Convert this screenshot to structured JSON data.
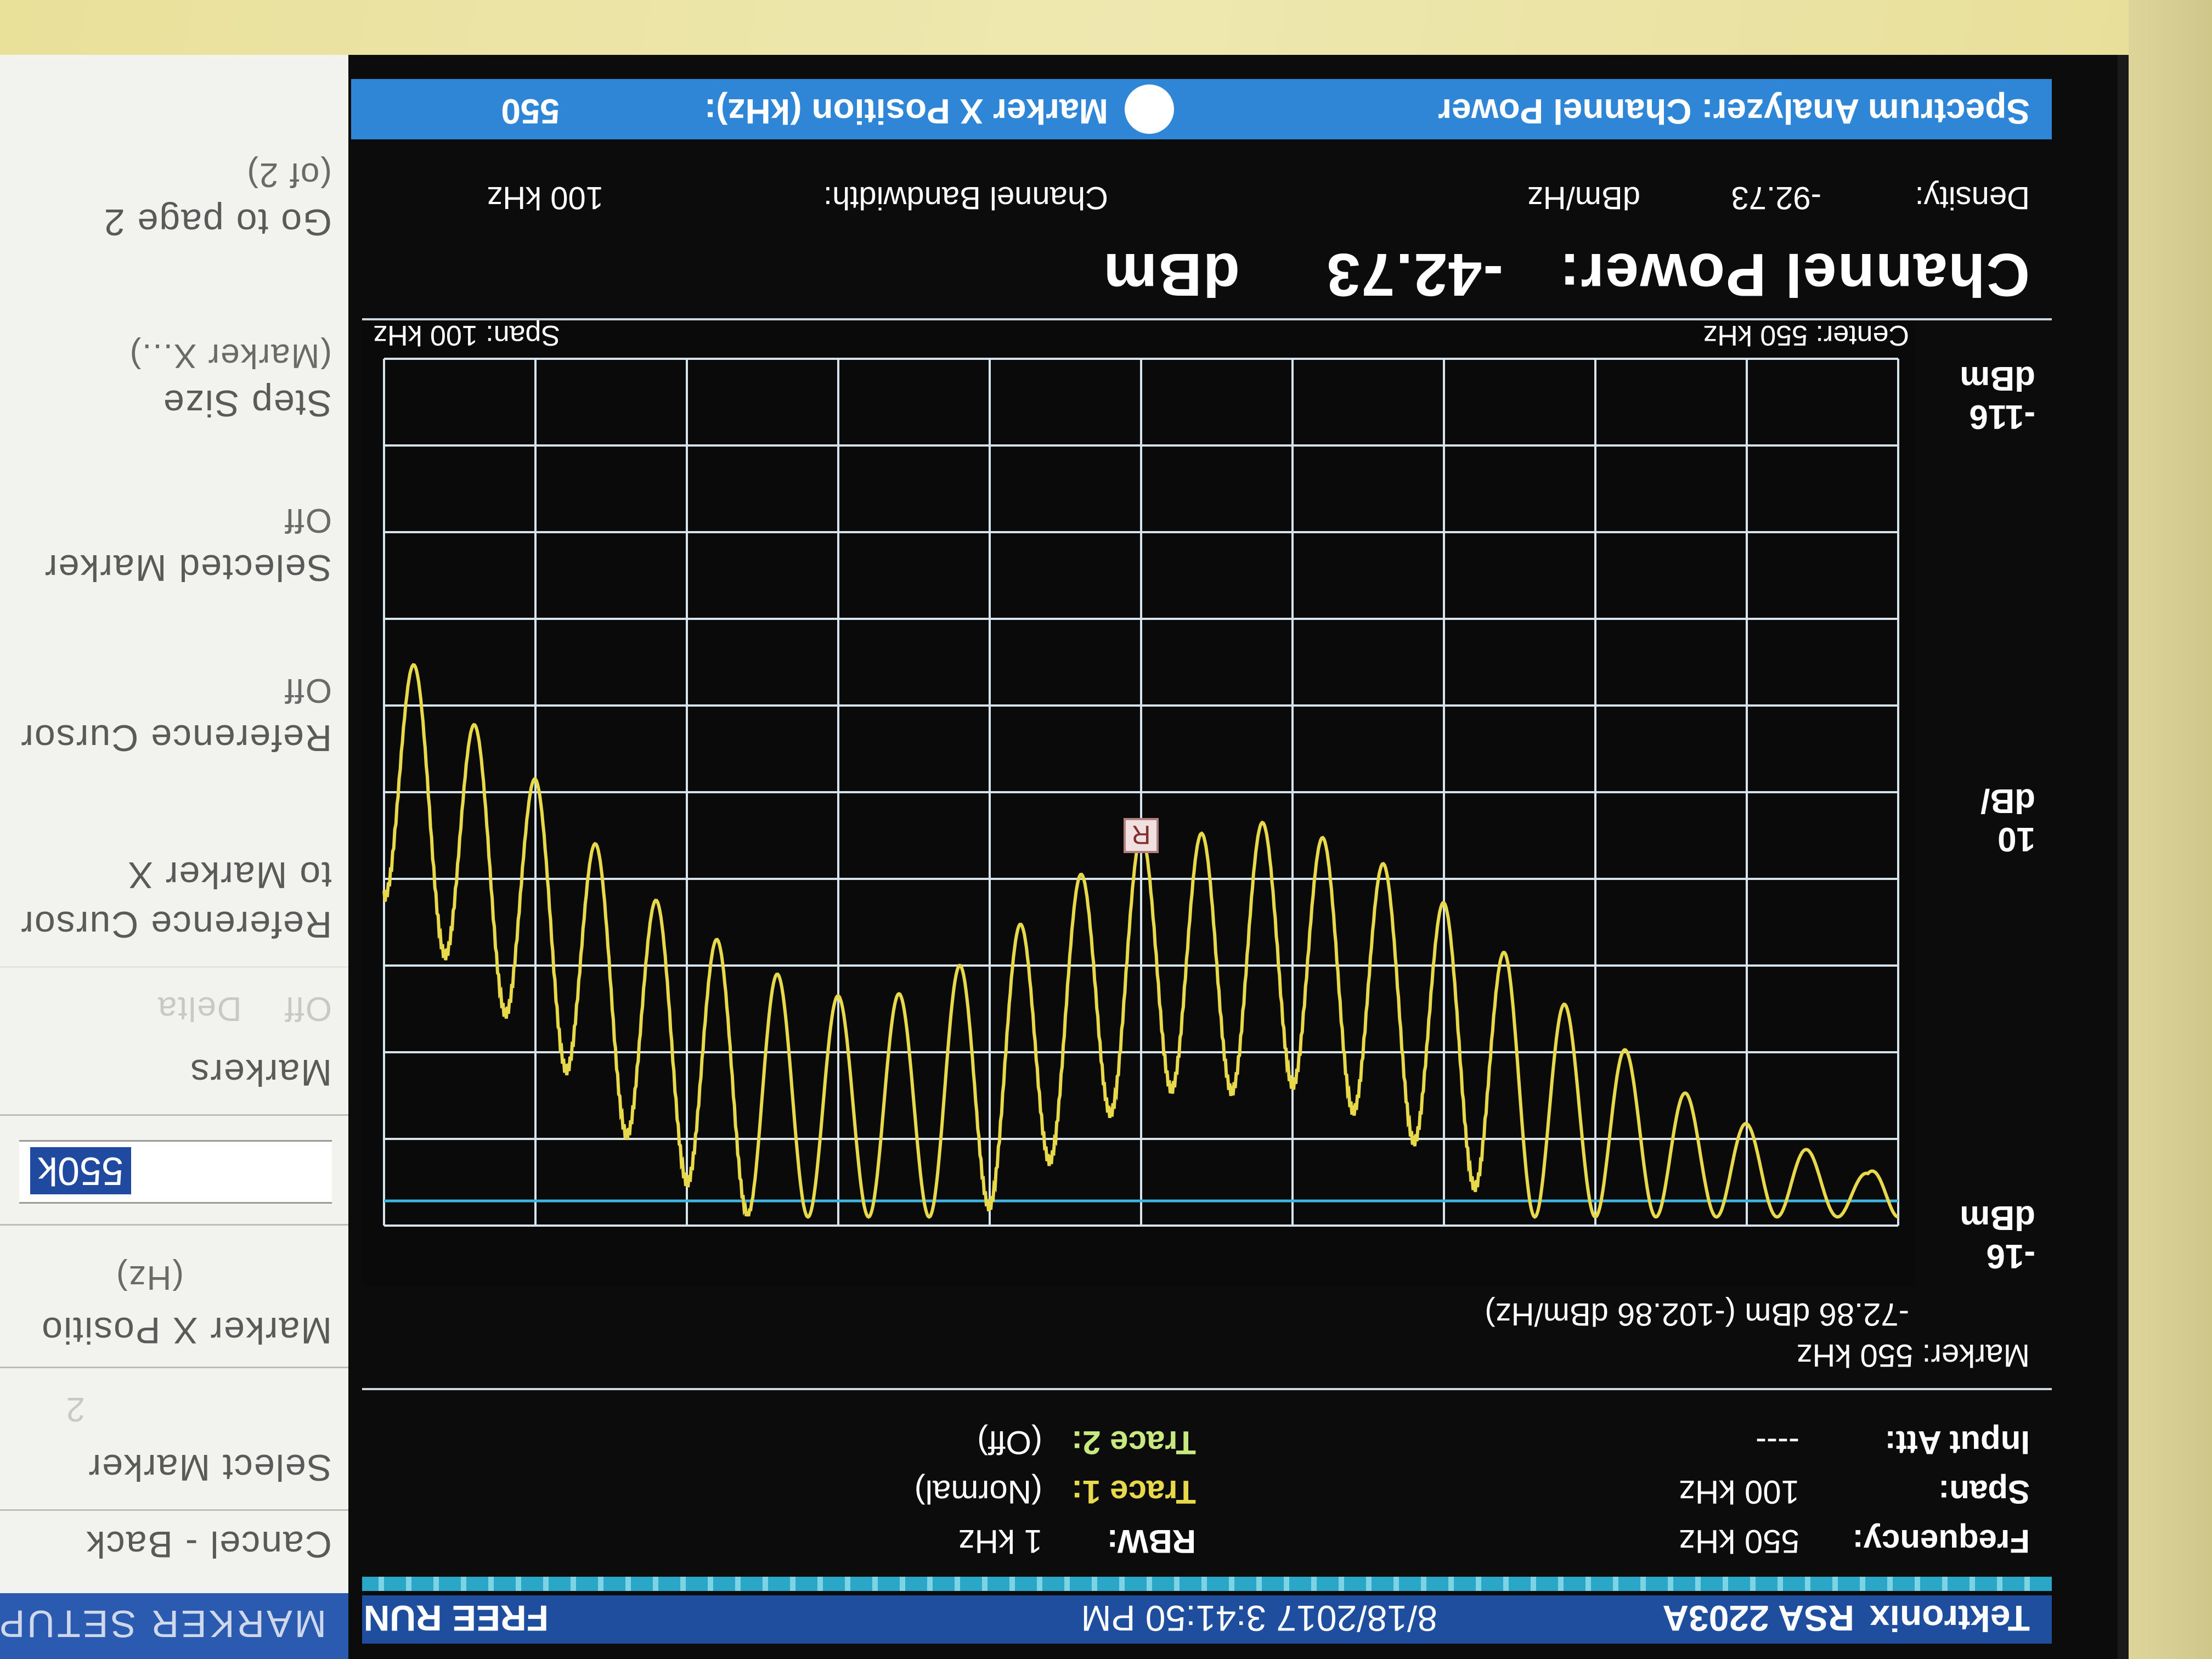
{
  "status": {
    "brand": "Tektronix",
    "model": "RSA 2203A",
    "datetime": "8/18/2017 3:41:50 PM",
    "run_state": "FREE RUN"
  },
  "params": {
    "frequency_label": "Frequency:",
    "frequency_value": "550 kHz",
    "rbw_label": "RBW:",
    "rbw_value": "1 kHz",
    "span_label": "Span:",
    "span_value": "100 kHz",
    "trace1_label": "Trace 1:",
    "trace1_value": "(Normal)",
    "input_att_label": "Input Att:",
    "input_att_value": "----",
    "trace2_label": "Trace 2:",
    "trace2_value": "(Off)"
  },
  "marker": {
    "line1": "Marker: 550 kHz",
    "line2": "-72.86 dBm (-102.86 dBm/Hz)",
    "glyph": "R"
  },
  "plot": {
    "y_top": "-16",
    "y_top_unit": "dBm",
    "y_div": "10",
    "y_div_unit": "dB/",
    "y_bottom": "-116",
    "y_bottom_unit": "dBm",
    "center": "Center: 550 kHz",
    "span": "Span: 100 kHz",
    "trace_color": "#e8d94a",
    "grid_color": "#d8e4ec",
    "marker_line_color": "#3fb6e0"
  },
  "chart_data": {
    "type": "line",
    "xlabel": "",
    "ylabel": "",
    "xlim": [
      500,
      600
    ],
    "ylim": [
      -116,
      -16
    ],
    "grid": true,
    "series": [
      {
        "x": [
          500,
          502,
          505,
          509,
          513,
          517,
          521,
          525,
          529,
          533,
          537,
          541,
          545,
          549,
          553,
          557,
          561,
          565,
          569,
          573,
          577,
          581,
          585,
          589,
          593,
          597,
          600
        ],
        "values": [
          -26,
          -22,
          -24,
          -27,
          -30,
          -35,
          -40,
          -46,
          -52,
          -57,
          -60,
          -63,
          -61,
          -62,
          -58,
          -52,
          -47,
          -43,
          -42,
          -44,
          -48,
          -52,
          -58,
          -66,
          -72,
          -79,
          -84
        ]
      }
    ]
  },
  "readout": {
    "channel_power_label": "Channel Power:",
    "channel_power_value": "-42.73",
    "channel_power_unit": "dBm",
    "density_label": "Density:",
    "density_value": "-92.73",
    "density_unit": "dBm/Hz",
    "bandwidth_label": "Channel Bandwidth:",
    "bandwidth_value": "100 kHz"
  },
  "titlebar": {
    "left": "Spectrum Analyzer: Channel Power",
    "center": "Marker X Position (kHz):",
    "value": "550"
  },
  "menu": {
    "title": "MARKER SETUP",
    "cancel": "Cancel - Back",
    "select_marker": "Select Marker",
    "select_marker_value": "2",
    "marker_x_position": "Marker X Positio",
    "marker_x_unit": "(Hz)",
    "marker_x_value": "550k",
    "markers": "Markers",
    "markers_sub": "Off    Delta",
    "ref_to_marker_line1": "Reference Cursor",
    "ref_to_marker_line2": "to Marker X",
    "ref_cursor": "Reference Cursor",
    "ref_cursor_value": "Off",
    "selected_marker": "Selected Marker",
    "selected_marker_value": "Off",
    "step_size": "Step Size",
    "step_size_value": "(Marker X...)",
    "goto_page": "Go to page 2",
    "goto_page_sub": "(of 2)"
  }
}
